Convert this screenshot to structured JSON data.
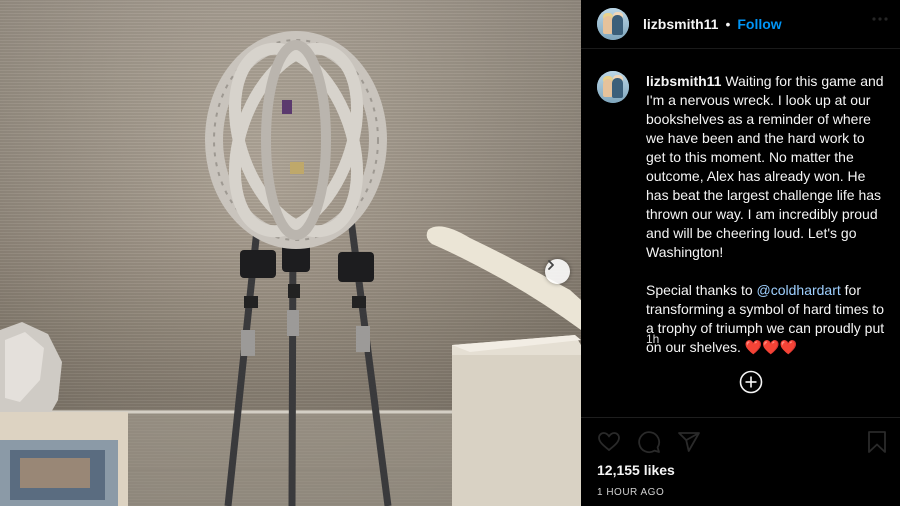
{
  "post": {
    "next_icon": "chevron-right-icon",
    "more_icon": "more-options-icon"
  },
  "header": {
    "username": "lizbsmith11",
    "separator": "•",
    "follow_label": "Follow"
  },
  "caption": {
    "username": "lizbsmith11",
    "paragraph1": "Waiting for this game and I'm a nervous wreck. I look up at our bookshelves as a reminder of where we have been and the hard work to get to this moment. No matter the outcome, Alex has already won. He has beat the largest challenge life has thrown our way. I am incredibly proud and will be cheering loud. Let's go Washington!",
    "paragraph2_prefix": "Special thanks to ",
    "mention": "@coldhardart",
    "paragraph2_suffix": " for transforming a symbol of hard times to a trophy of triumph we can proudly put on our shelves. ❤️❤️❤️",
    "age": "1h"
  },
  "actions": {
    "icons": [
      "heart-icon",
      "comment-icon",
      "share-icon",
      "bookmark-icon"
    ],
    "add_comment_icon": "plus-circle-icon"
  },
  "likes": {
    "text": "12,155 likes"
  },
  "posted": {
    "text": "1 HOUR AGO"
  },
  "colors": {
    "background": "#000000",
    "accent": "#0095f6",
    "mention": "#9fd0ff",
    "heart": "#e0245e"
  }
}
